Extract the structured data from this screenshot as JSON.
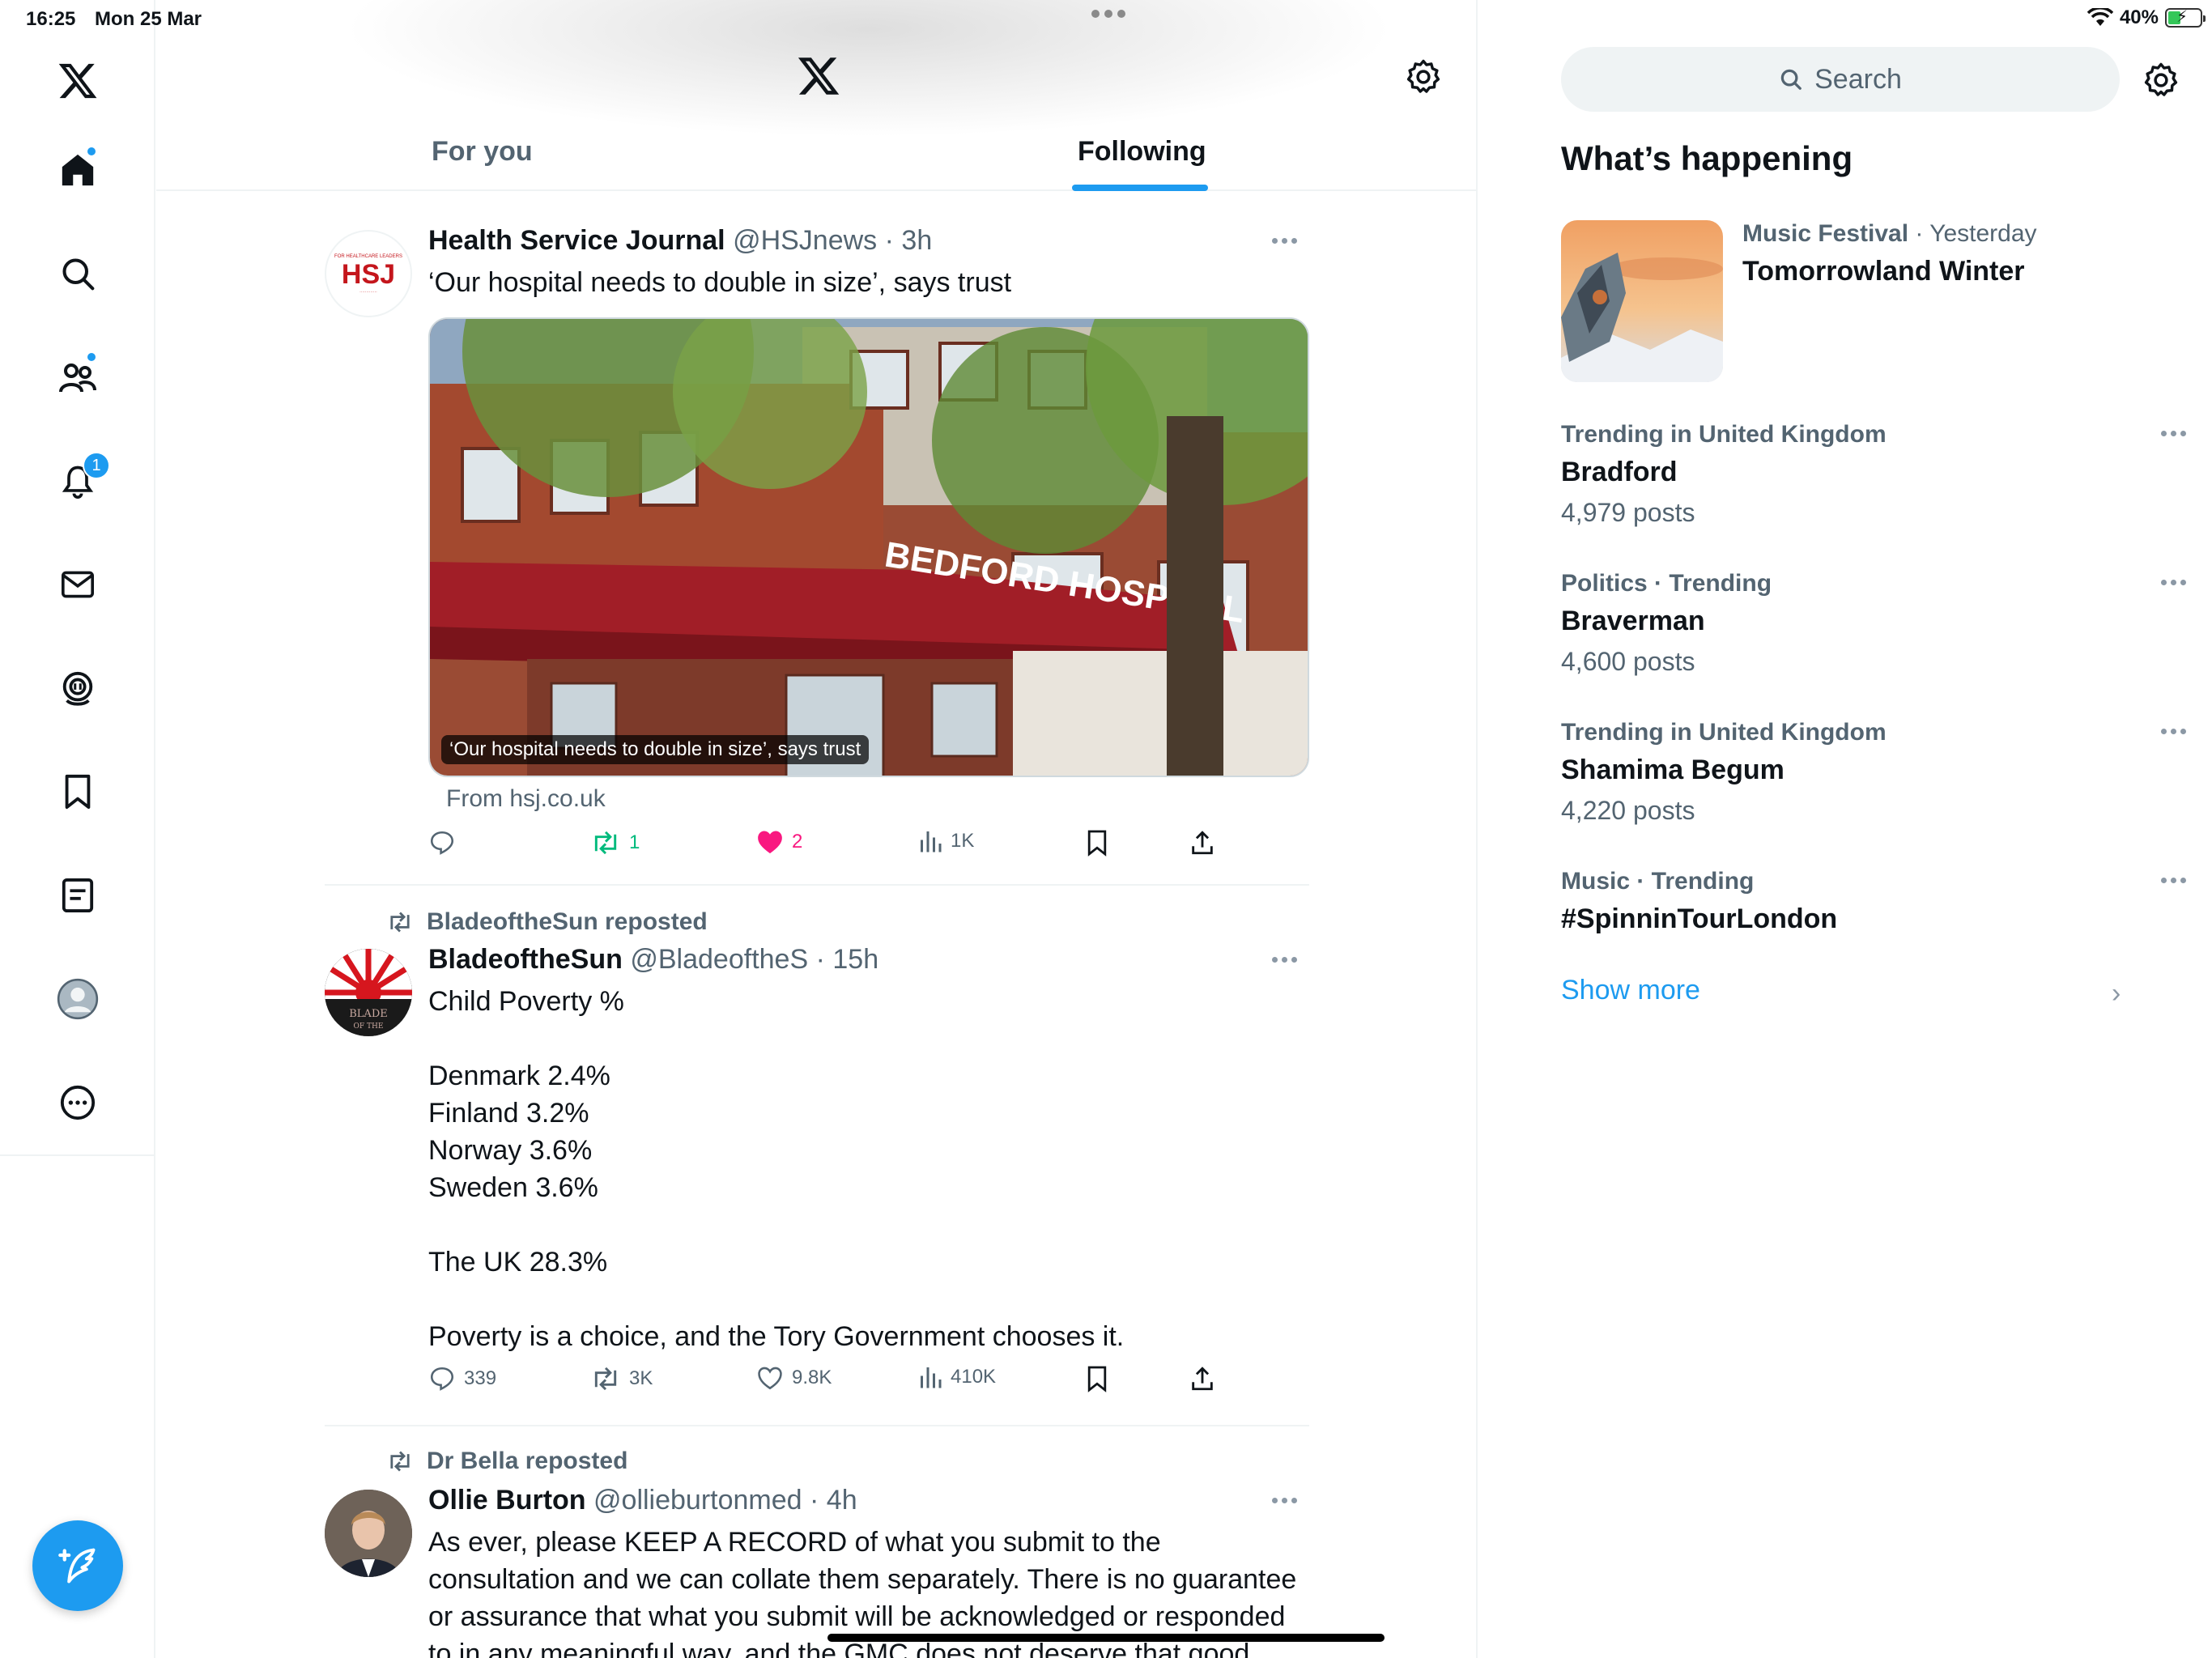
{
  "status_bar": {
    "time": "16:25",
    "date": "Mon 25 Mar",
    "battery": "40%"
  },
  "nav": {
    "notifications_badge": "1"
  },
  "header": {
    "tabs": [
      {
        "label": "For you"
      },
      {
        "label": "Following"
      }
    ]
  },
  "posts": [
    {
      "name": "Health Service Journal",
      "handle": "@HSJnews",
      "time": "3h",
      "text": "‘Our hospital needs to double in size’, says trust",
      "media_caption": "‘Our hospital needs to double in size’, says trust",
      "media_sign": "BEDFORD HOSPITAL",
      "avatar_text": "HSJ",
      "link_source": "From hsj.co.uk",
      "stats": {
        "replies": "",
        "reposts": "1",
        "likes": "2",
        "views": "1K"
      }
    },
    {
      "repost_by": "BladeoftheSun reposted",
      "name": "BladeoftheSun",
      "handle": "@BladeoftheS",
      "time": "15h",
      "text": "Child Poverty %\n\nDenmark 2.4%\nFinland 3.2%\nNorway 3.6%\nSweden 3.6%\n\nThe UK 28.3%\n\nPoverty is a choice, and the Tory Government chooses it.",
      "stats": {
        "replies": "339",
        "reposts": "3K",
        "likes": "9.8K",
        "views": "410K"
      }
    },
    {
      "repost_by": "Dr Bella reposted",
      "name": "Ollie Burton",
      "handle": "@ollieburtonmed",
      "time": "4h",
      "text": "As ever, please KEEP A RECORD of what you submit to the consultation and we can collate them separately. There is no guarantee or assurance that what you submit will be acknowledged or responded to in any meaningful way, and the GMC does not deserve that good faith.",
      "stats": {
        "replies": "",
        "reposts": "",
        "likes": "",
        "views": ""
      }
    }
  ],
  "sidebar": {
    "search_placeholder": "Search",
    "title": "What’s happening",
    "featured": {
      "category": "Music Festival",
      "when": "Yesterday",
      "title": "Tomorrowland Winter"
    },
    "trends": [
      {
        "meta": "Trending in United Kingdom",
        "topic": "Bradford",
        "count": "4,979 posts"
      },
      {
        "meta": "Politics · Trending",
        "topic": "Braverman",
        "count": "4,600 posts"
      },
      {
        "meta": "Trending in United Kingdom",
        "topic": "Shamima Begum",
        "count": "4,220 posts"
      },
      {
        "meta": "Music · Trending",
        "topic": "#SpinninTourLondon",
        "count": ""
      }
    ],
    "show_more": "Show more"
  },
  "colors": {
    "accent": "#1d9bf0",
    "like": "#f91880",
    "repost": "#00ba7c",
    "muted": "#536471"
  }
}
